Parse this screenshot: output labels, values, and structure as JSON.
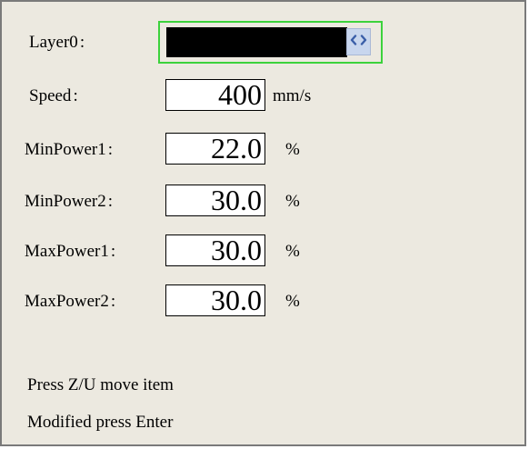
{
  "layer": {
    "label": "Layer0",
    "colon": ":"
  },
  "speed": {
    "label": "Speed",
    "colon": ":",
    "value": "400",
    "unit": "mm/s"
  },
  "min_power_1": {
    "label": "MinPower1",
    "colon": ":",
    "value": "22.0",
    "unit": "%"
  },
  "min_power_2": {
    "label": "MinPower2",
    "colon": ":",
    "value": "30.0",
    "unit": "%"
  },
  "max_power_1": {
    "label": "MaxPower1",
    "colon": ":",
    "value": "30.0",
    "unit": "%"
  },
  "max_power_2": {
    "label": "MaxPower2",
    "colon": ":",
    "value": "30.0",
    "unit": "%"
  },
  "footer": {
    "hint_move": "Press Z/U move item",
    "hint_enter": "Modified press Enter"
  },
  "colors": {
    "panel_bg": "#ece9e0",
    "focus_border": "#3cd23c",
    "spin_bg": "#c8d6ee",
    "spin_arrows": "#3a5ea8"
  },
  "icons": {
    "layer_spin": "left-right-chevrons-icon"
  }
}
